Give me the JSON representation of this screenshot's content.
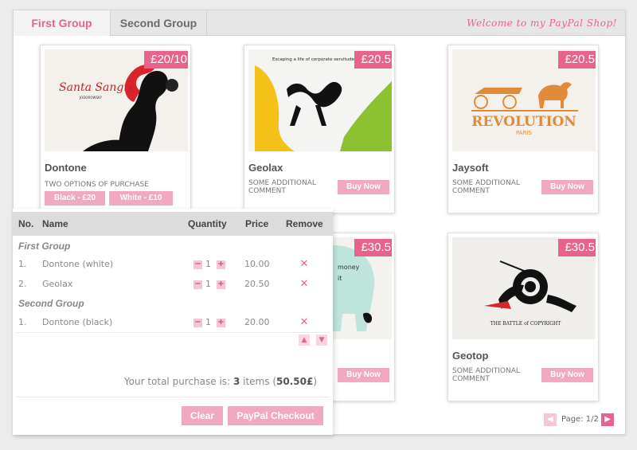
{
  "tabs": [
    {
      "label": "First Group",
      "active": true
    },
    {
      "label": "Second Group",
      "active": false
    }
  ],
  "welcome": "Welcome to my PayPal Shop!",
  "products": [
    {
      "name": "Dontone",
      "price": "£20/10",
      "comment": "TWO OPTIONS OF PURCHASE",
      "options": [
        "Black - £20",
        "White - £10"
      ],
      "image_text": "Santa Sangre"
    },
    {
      "name": "Geolax",
      "price": "£20.5",
      "comment": "SOME ADDITIONAL COMMENT",
      "buy_label": "Buy Now",
      "image_text": "Escaping a life of corporate servitude."
    },
    {
      "name": "Jaysoft",
      "price": "£20.5",
      "comment": "SOME ADDITIONAL COMMENT",
      "buy_label": "Buy Now",
      "image_text": "REVOLUTION",
      "image_subtext": "PARIS"
    },
    {
      "name": "",
      "price": "£30.5",
      "comment": "",
      "buy_label": "Buy Now"
    },
    {
      "name": "Geotop",
      "price": "£30.5",
      "comment": "SOME ADDITIONAL COMMENT",
      "buy_label": "Buy Now",
      "image_text": "THE BATTLE of COPYRIGHT"
    }
  ],
  "pager": {
    "label": "Page: 1/2"
  },
  "cart": {
    "headers": {
      "no": "No.",
      "name": "Name",
      "quantity": "Quantity",
      "price": "Price",
      "remove": "Remove"
    },
    "groups": [
      {
        "label": "First Group",
        "items": [
          {
            "no": "1.",
            "name": "Dontone (white)",
            "qty": "1",
            "price": "10.00"
          },
          {
            "no": "2.",
            "name": "Geolax",
            "qty": "1",
            "price": "20.50"
          }
        ]
      },
      {
        "label": "Second Group",
        "items": [
          {
            "no": "1.",
            "name": "Dontone (black)",
            "qty": "1",
            "price": "20.00"
          }
        ]
      }
    ],
    "total_prefix": "Your total purchase is:",
    "total_items": "3",
    "total_items_word": "items",
    "total_amount": "50.50£",
    "clear_label": "Clear",
    "checkout_label": "PayPal Checkout"
  },
  "colors": {
    "accent": "#e8638b",
    "button": "#f2a8bf",
    "header_bg": "#dcdcdc"
  }
}
